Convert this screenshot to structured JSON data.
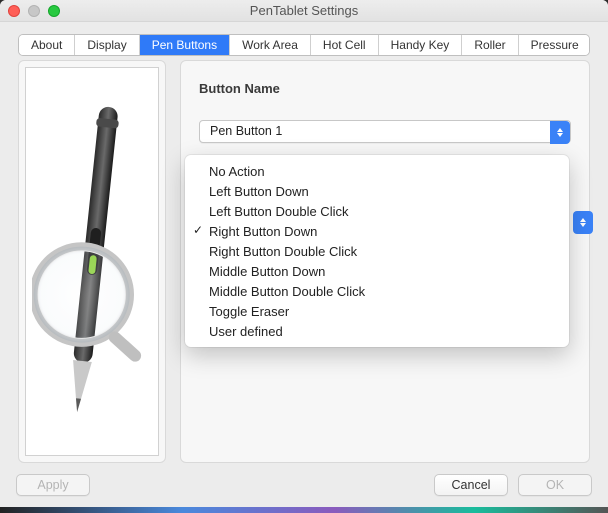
{
  "window": {
    "title": "PenTablet Settings"
  },
  "tabs": [
    {
      "label": "About"
    },
    {
      "label": "Display"
    },
    {
      "label": "Pen Buttons"
    },
    {
      "label": "Work Area"
    },
    {
      "label": "Hot Cell"
    },
    {
      "label": "Handy Key"
    },
    {
      "label": "Roller"
    },
    {
      "label": "Pressure"
    }
  ],
  "active_tab_index": 2,
  "panel": {
    "label_button_name": "Button Name",
    "selected_button": "Pen Button 1",
    "options": [
      "No Action",
      "Left Button Down",
      "Left Button Double Click",
      "Right Button Down",
      "Right Button Double Click",
      "Middle Button Down",
      "Middle Button Double Click",
      "Toggle Eraser",
      "User defined"
    ],
    "checked_option_index": 3
  },
  "footer": {
    "apply": "Apply",
    "cancel": "Cancel",
    "ok": "OK"
  }
}
